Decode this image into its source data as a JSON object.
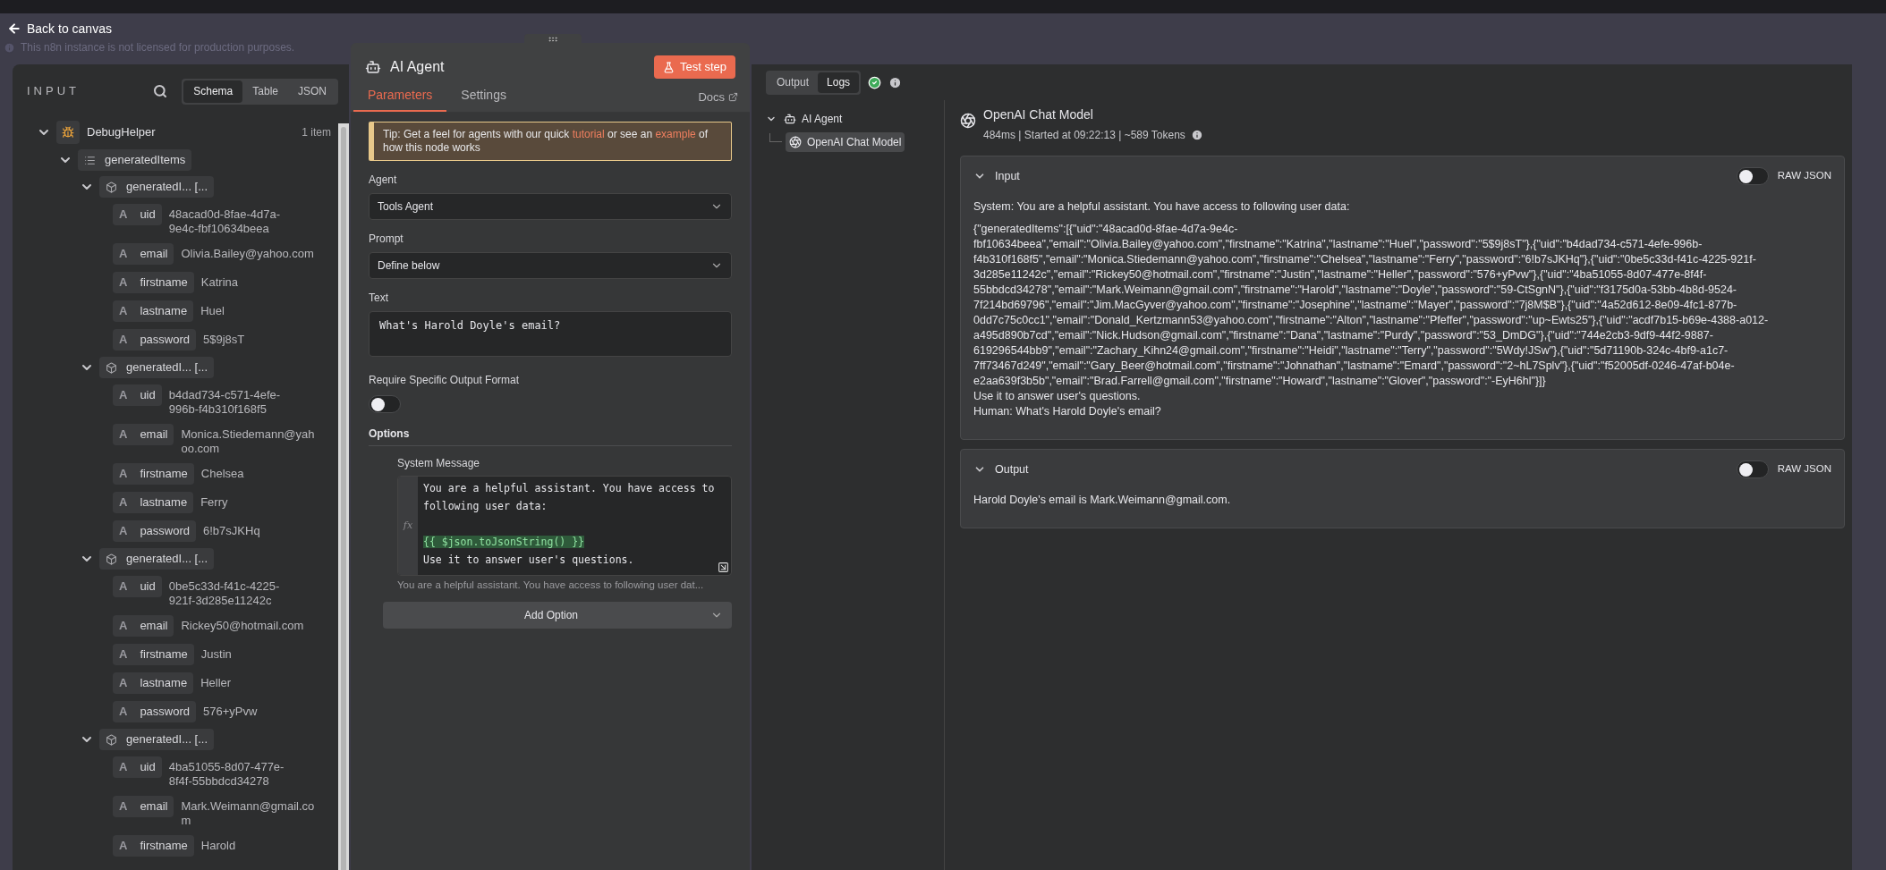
{
  "back_link": "Back to canvas",
  "license_notice": "This n8n instance is not licensed for production purposes.",
  "input_panel": {
    "title": "INPUT",
    "view_tabs": [
      {
        "label": "Schema",
        "selected": true
      },
      {
        "label": "Table",
        "selected": false
      },
      {
        "label": "JSON",
        "selected": false
      }
    ],
    "tree": [
      {
        "kind": "node",
        "label": "DebugHelper",
        "count": "1 item",
        "expanded": true,
        "children": [
          {
            "kind": "list",
            "label": "generatedItems",
            "expanded": true,
            "children": [
              {
                "kind": "object",
                "label": "generatedI... [...",
                "expanded": true,
                "children": [
                  {
                    "kind": "string",
                    "type": "A",
                    "key": "uid",
                    "value": "48acad0d-8fae-4d7a-9e4c-fbf10634beea"
                  },
                  {
                    "kind": "string",
                    "type": "A",
                    "key": "email",
                    "value": "Olivia.Bailey@yahoo.com"
                  },
                  {
                    "kind": "string",
                    "type": "A",
                    "key": "firstname",
                    "value": "Katrina"
                  },
                  {
                    "kind": "string",
                    "type": "A",
                    "key": "lastname",
                    "value": "Huel"
                  },
                  {
                    "kind": "string",
                    "type": "A",
                    "key": "password",
                    "value": "5$9j8sT"
                  }
                ]
              },
              {
                "kind": "object",
                "label": "generatedI... [...",
                "expanded": true,
                "children": [
                  {
                    "kind": "string",
                    "type": "A",
                    "key": "uid",
                    "value": "b4dad734-c571-4efe-996b-f4b310f168f5"
                  },
                  {
                    "kind": "string",
                    "type": "A",
                    "key": "email",
                    "value": "Monica.Stiedemann@yahoo.com"
                  },
                  {
                    "kind": "string",
                    "type": "A",
                    "key": "firstname",
                    "value": "Chelsea"
                  },
                  {
                    "kind": "string",
                    "type": "A",
                    "key": "lastname",
                    "value": "Ferry"
                  },
                  {
                    "kind": "string",
                    "type": "A",
                    "key": "password",
                    "value": "6!b7sJKHq"
                  }
                ]
              },
              {
                "kind": "object",
                "label": "generatedI... [...",
                "expanded": true,
                "children": [
                  {
                    "kind": "string",
                    "type": "A",
                    "key": "uid",
                    "value": "0be5c33d-f41c-4225-921f-3d285e11242c"
                  },
                  {
                    "kind": "string",
                    "type": "A",
                    "key": "email",
                    "value": "Rickey50@hotmail.com"
                  },
                  {
                    "kind": "string",
                    "type": "A",
                    "key": "firstname",
                    "value": "Justin"
                  },
                  {
                    "kind": "string",
                    "type": "A",
                    "key": "lastname",
                    "value": "Heller"
                  },
                  {
                    "kind": "string",
                    "type": "A",
                    "key": "password",
                    "value": "576+yPvw"
                  }
                ]
              },
              {
                "kind": "object",
                "label": "generatedI... [...",
                "expanded": true,
                "children": [
                  {
                    "kind": "string",
                    "type": "A",
                    "key": "uid",
                    "value": "4ba51055-8d07-477e-8f4f-55bbdcd34278"
                  },
                  {
                    "kind": "string",
                    "type": "A",
                    "key": "email",
                    "value": "Mark.Weimann@gmail.com"
                  },
                  {
                    "kind": "string",
                    "type": "A",
                    "key": "firstname",
                    "value": "Harold"
                  }
                ]
              }
            ]
          }
        ]
      }
    ]
  },
  "node_panel": {
    "title": "AI Agent",
    "test_button": "Test step",
    "tabs": [
      {
        "label": "Parameters",
        "selected": true
      },
      {
        "label": "Settings",
        "selected": false
      }
    ],
    "docs_link": "Docs",
    "tip": {
      "before": "Tip: Get a feel for agents with our quick ",
      "link_1": "tutorial",
      "middle": " or see an ",
      "link_2": "example",
      "after": " of how this node works"
    },
    "agent": {
      "label": "Agent",
      "value": "Tools Agent"
    },
    "prompt": {
      "label": "Prompt",
      "value": "Define below"
    },
    "text": {
      "label": "Text",
      "value": "What's Harold Doyle's email?"
    },
    "output_format": {
      "label": "Require Specific Output Format",
      "on": false
    },
    "options_heading": "Options",
    "system_message": {
      "label": "System Message",
      "gutter": "fx",
      "lines": [
        {
          "kind": "plain",
          "text": "You are a helpful assistant. You have access to following user data:"
        },
        {
          "kind": "blank"
        },
        {
          "kind": "expression",
          "text": "{{ $json.toJsonString() }}"
        },
        {
          "kind": "plain",
          "text": "Use it to answer user's questions."
        }
      ],
      "preview": "You are a helpful assistant. You have access to following user dat..."
    },
    "add_option": "Add Option"
  },
  "output_panel": {
    "tabs": [
      {
        "label": "Output",
        "selected": false
      },
      {
        "label": "Logs",
        "selected": true
      }
    ],
    "logs_tree": [
      {
        "label": "AI Agent",
        "kind": "agent",
        "expanded": true,
        "selected": false,
        "children": [
          {
            "label": "OpenAI Chat Model",
            "kind": "model",
            "selected": true
          }
        ]
      }
    ],
    "detail": {
      "title": "OpenAI Chat Model",
      "meta": "484ms | Started at 09:22:13 | ~589 Tokens",
      "sections": [
        {
          "title": "Input",
          "expanded": true,
          "raw_json_label": "RAW JSON",
          "raw_json": false,
          "paragraphs": [
            "System: You are a helpful assistant. You have access to following user data:",
            "{\"generatedItems\":[{\"uid\":\"48acad0d-8fae-4d7a-9e4c-fbf10634beea\",\"email\":\"Olivia.Bailey@yahoo.com\",\"firstname\":\"Katrina\",\"lastname\":\"Huel\",\"password\":\"5$9j8sT\"},{\"uid\":\"b4dad734-c571-4efe-996b-f4b310f168f5\",\"email\":\"Monica.Stiedemann@yahoo.com\",\"firstname\":\"Chelsea\",\"lastname\":\"Ferry\",\"password\":\"6!b7sJKHq\"},{\"uid\":\"0be5c33d-f41c-4225-921f-3d285e11242c\",\"email\":\"Rickey50@hotmail.com\",\"firstname\":\"Justin\",\"lastname\":\"Heller\",\"password\":\"576+yPvw\"},{\"uid\":\"4ba51055-8d07-477e-8f4f-55bbdcd34278\",\"email\":\"Mark.Weimann@gmail.com\",\"firstname\":\"Harold\",\"lastname\":\"Doyle\",\"password\":\"59-CtSgnN\"},{\"uid\":\"f3175d0a-53bb-4b8d-9524-7f214bd69796\",\"email\":\"Jim.MacGyver@yahoo.com\",\"firstname\":\"Josephine\",\"lastname\":\"Mayer\",\"password\":\"7j8M$B\"},{\"uid\":\"4a52d612-8e09-4fc1-877b-0dd7c75c0cc1\",\"email\":\"Donald_Kertzmann53@yahoo.com\",\"firstname\":\"Alton\",\"lastname\":\"Pfeffer\",\"password\":\"up~Ewts25\"},{\"uid\":\"acdf7b15-b69e-4388-a012-a495d890b7cd\",\"email\":\"Nick.Hudson@gmail.com\",\"firstname\":\"Dana\",\"lastname\":\"Purdy\",\"password\":\"53_DmDG\"},{\"uid\":\"744e2cb3-9df9-44f2-9887-619296544bb9\",\"email\":\"Zachary_Kihn24@gmail.com\",\"firstname\":\"Heidi\",\"lastname\":\"Terry\",\"password\":\"5Wdy!JSw\"},{\"uid\":\"5d71190b-324c-4bf9-a1c7-7ff73467d249\",\"email\":\"Gary_Beer@hotmail.com\",\"firstname\":\"Johnathan\",\"lastname\":\"Emard\",\"password\":\"2~hL7Splv\"},{\"uid\":\"f52005df-0246-47af-b04e-e2aa639f3b5b\",\"email\":\"Brad.Farrell@gmail.com\",\"firstname\":\"Howard\",\"lastname\":\"Glover\",\"password\":\"-EyH6hl\"}]}\nUse it to answer user's questions.\nHuman: What's Harold Doyle's email?"
          ]
        },
        {
          "title": "Output",
          "expanded": true,
          "raw_json_label": "RAW JSON",
          "raw_json": false,
          "paragraphs": [
            "Harold Doyle's email is Mark.Weimann@gmail.com."
          ]
        }
      ]
    }
  }
}
